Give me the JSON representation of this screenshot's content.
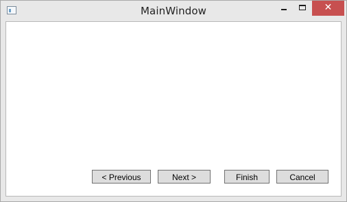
{
  "window": {
    "title": "MainWindow",
    "controls": {
      "minimize_icon": "minimize-icon",
      "maximize_icon": "maximize-icon",
      "close_icon": "close-icon",
      "close_glyph": "✕"
    }
  },
  "wizard": {
    "previous_label": "< Previous",
    "next_label": "Next >",
    "finish_label": "Finish",
    "cancel_label": "Cancel"
  },
  "colors": {
    "close_button": "#c75050",
    "window_frame": "#e8e8e8",
    "button_face": "#dddddd"
  }
}
